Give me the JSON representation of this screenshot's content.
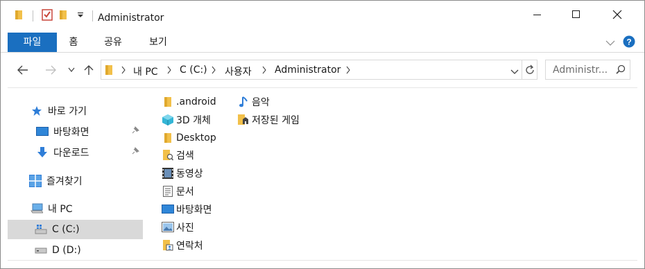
{
  "titlebar": {
    "title": "Administrator"
  },
  "ribbon": {
    "tabs": [
      "파일",
      "홈",
      "공유",
      "보기"
    ]
  },
  "address": {
    "crumbs": [
      "내 PC",
      "C (C:)",
      "사용자",
      "Administrator"
    ]
  },
  "search": {
    "placeholder": "Administr..."
  },
  "nav": {
    "quick_access": "바로 가기",
    "quick_items": [
      "바탕화면",
      "다운로드"
    ],
    "favorites": "즐겨찾기",
    "this_pc": "내 PC",
    "drives": [
      "C (C:)",
      "D (D:)"
    ]
  },
  "files": {
    "col1": [
      ".android",
      "3D 개체",
      "Desktop",
      "검색",
      "동영상",
      "문서",
      "바탕화면",
      "사진",
      "연락처"
    ],
    "col2": [
      "음악",
      "저장된 게임"
    ]
  },
  "colors": {
    "accent": "#1a6fc0",
    "folder": "#f2c04a",
    "selected": "#d9d9d9"
  }
}
